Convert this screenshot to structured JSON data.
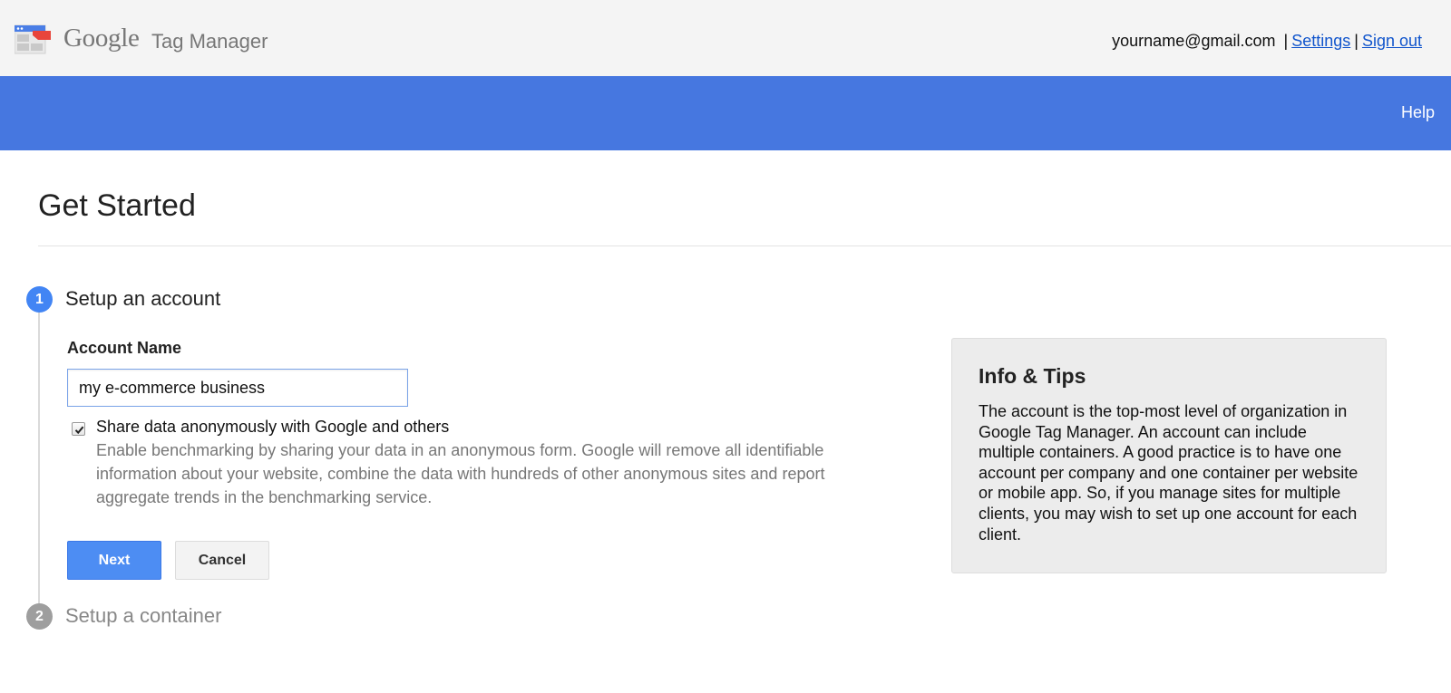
{
  "header": {
    "brand_google": "Google",
    "brand_product": "Tag Manager",
    "account_email": "yourname@gmail.com",
    "separator": "|",
    "settings_label": "Settings",
    "signout_label": "Sign out"
  },
  "nav": {
    "help_label": "Help"
  },
  "page": {
    "title": "Get Started"
  },
  "steps": [
    {
      "number": "1",
      "title": "Setup an account",
      "state": "active"
    },
    {
      "number": "2",
      "title": "Setup a container",
      "state": "inactive"
    }
  ],
  "form": {
    "account_name_label": "Account Name",
    "account_name_value": "my e-commerce business",
    "share_checkbox_checked": true,
    "share_checkbox_label": "Share data anonymously with Google and others",
    "share_checkbox_help": "Enable benchmarking by sharing your data in an anonymous form. Google will remove all identifiable information about your website, combine the data with hundreds of other anonymous sites and report aggregate trends in the benchmarking service.",
    "next_label": "Next",
    "cancel_label": "Cancel"
  },
  "info": {
    "title": "Info & Tips",
    "body": "The account is the top-most level of organization in Google Tag Manager. An account can include multiple containers. A good practice is to have one account per company and one container per website or mobile app. So, if you manage sites for multiple clients, you may wish to set up one account for each client."
  },
  "colors": {
    "header_bg": "#f4f4f4",
    "nav_bg": "#4677e0",
    "primary_button": "#4d8df3",
    "step_active": "#4285f4",
    "step_inactive": "#9e9e9e",
    "link": "#1155cc",
    "info_panel_bg": "#ececec"
  },
  "icons": {
    "logo": "tag-manager-logo-icon",
    "checkmark": "checkmark-icon"
  }
}
